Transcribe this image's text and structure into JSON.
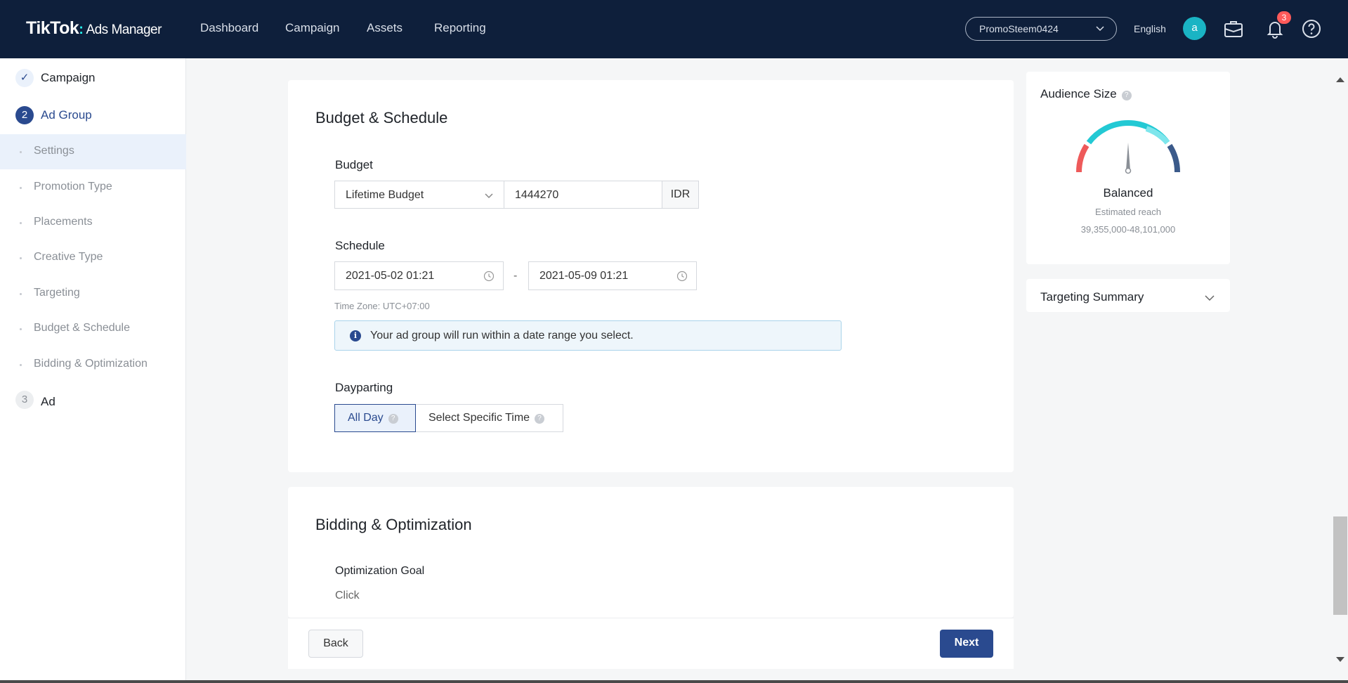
{
  "brand": {
    "logo": "TikTok",
    "logo_sub": "Ads Manager"
  },
  "nav": [
    "Dashboard",
    "Campaign",
    "Assets",
    "Reporting"
  ],
  "account": {
    "name": "PromoSteem0424"
  },
  "language": "English",
  "avatar_letter": "a",
  "notifications_count": "3",
  "sidebar": {
    "steps": [
      {
        "marker": "✓",
        "label": "Campaign"
      },
      {
        "marker": "2",
        "label": "Ad Group"
      },
      {
        "marker": "3",
        "label": "Ad"
      }
    ],
    "sub_items": [
      "Settings",
      "Promotion Type",
      "Placements",
      "Creative Type",
      "Targeting",
      "Budget & Schedule",
      "Bidding & Optimization"
    ]
  },
  "budget_schedule": {
    "title": "Budget & Schedule",
    "budget_label": "Budget",
    "budget_type": "Lifetime Budget",
    "budget_value": "1444270",
    "currency": "IDR",
    "schedule_label": "Schedule",
    "start": "2021-05-02 01:21",
    "separator": "-",
    "end": "2021-05-09 01:21",
    "timezone": "Time Zone: UTC+07:00",
    "info": "Your ad group will run within a date range you select.",
    "dayparting_label": "Dayparting",
    "dayparting_options": [
      "All Day",
      "Select Specific Time"
    ],
    "dayparting_selected": "All Day"
  },
  "bidding": {
    "title": "Bidding & Optimization",
    "goal_label": "Optimization Goal",
    "goal_value": "Click"
  },
  "footer": {
    "back": "Back",
    "next": "Next"
  },
  "audience": {
    "title": "Audience Size",
    "status": "Balanced",
    "reach_label": "Estimated reach",
    "reach": "39,355,000-48,101,000"
  },
  "targeting_summary": {
    "title": "Targeting Summary"
  },
  "colors": {
    "topbar": "#0e1f3b",
    "primary": "#2a4a8f",
    "accent": "#1ab4c4",
    "gauge_low": "#ee5a5a",
    "gauge_mid": "#23c9d4",
    "gauge_high": "#3b5a8a"
  }
}
